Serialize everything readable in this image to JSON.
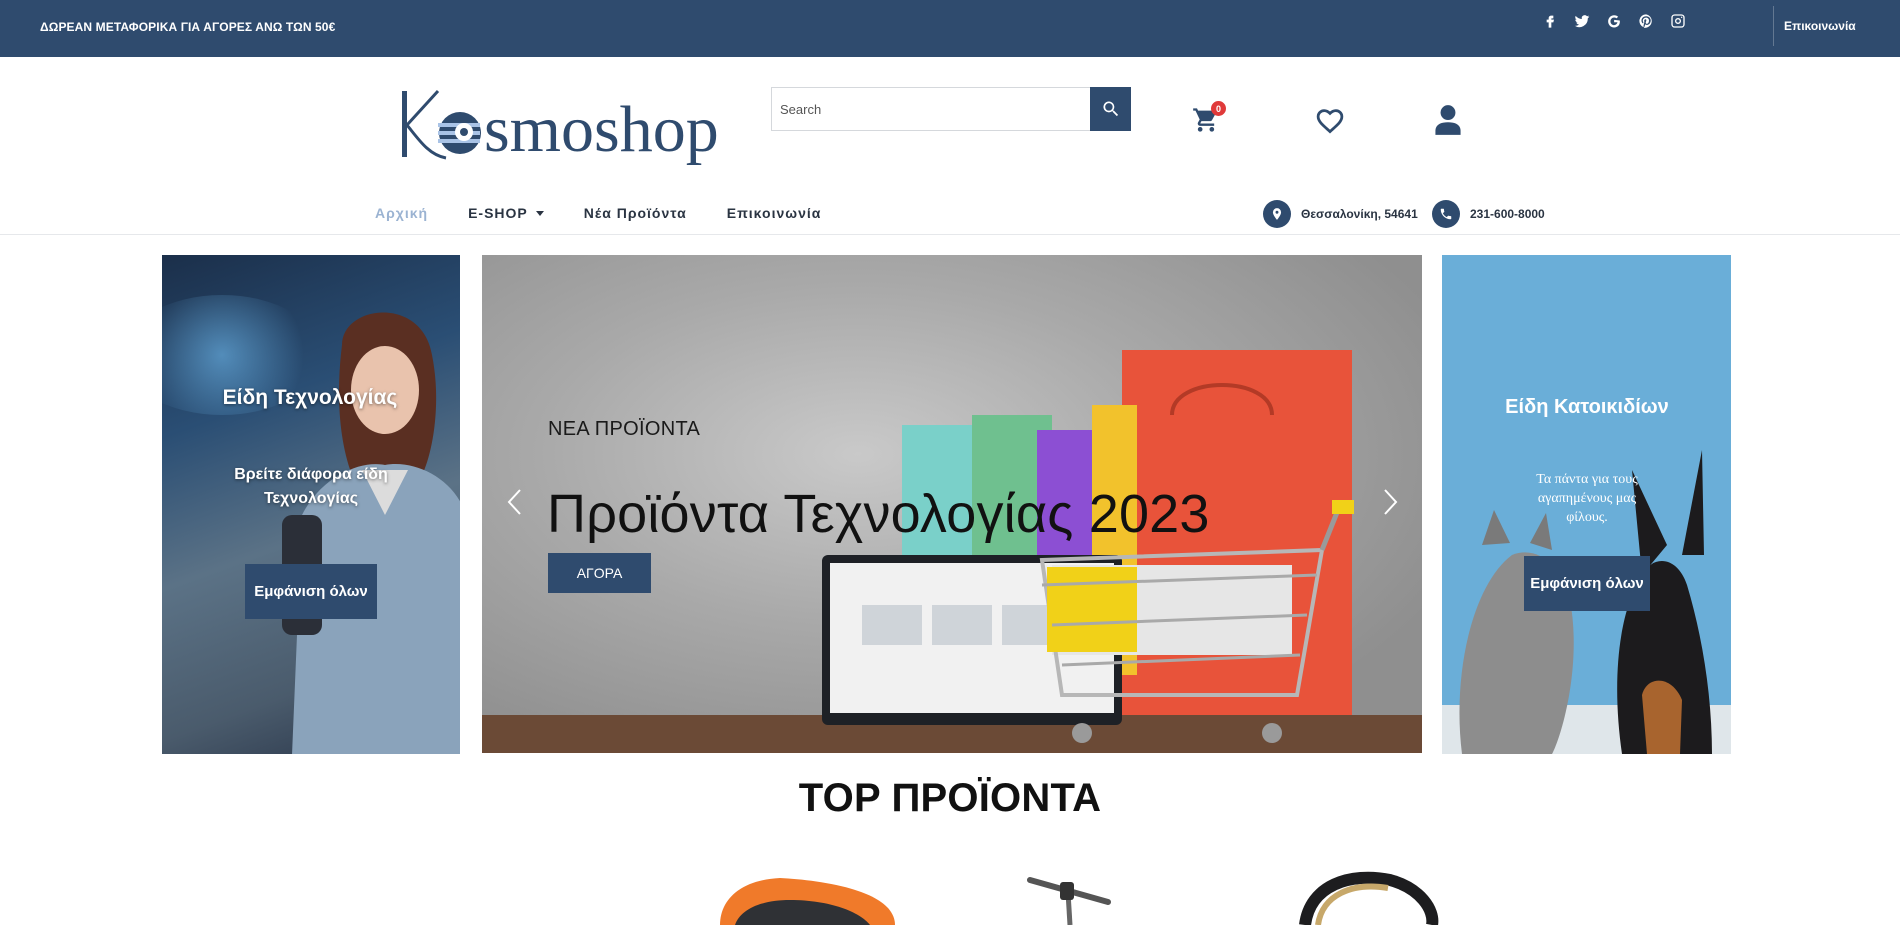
{
  "topbar": {
    "promo": "ΔΩΡΕΑΝ ΜΕΤΑΦΟΡΙΚΑ ΓΙΑ ΑΓΟΡΕΣ ΑΝΩ ΤΩΝ 50€",
    "social_icons": [
      "facebook-icon",
      "twitter-icon",
      "google-icon",
      "pinterest-icon",
      "instagram-icon"
    ],
    "contact_link": "Επικοινωνία"
  },
  "header": {
    "logo_text": "Kosmoshop",
    "search_placeholder": "Search",
    "cart_count": "0"
  },
  "nav": {
    "items": [
      "Αρχική",
      "E-SHOP",
      "Νέα Προϊόντα",
      "Επικοινωνία"
    ],
    "address": "Θεσσαλονίκη, 54641",
    "phone": "231-600-8000"
  },
  "left_banner": {
    "heading": "Είδη Τεχνολογίας",
    "text": "Βρείτε διάφορα είδη Τεχνολογίας",
    "button": "Εμφάνιση όλων"
  },
  "hero": {
    "kicker": "ΝΕΑ ΠΡΟΪΟΝΤΑ",
    "title": "Προϊόντα Τεχνολογίας 2023",
    "button": "ΑΓΟΡΑ"
  },
  "right_banner": {
    "heading": "Είδη Κατοικιδίων",
    "text": "Τα πάντα για τους αγαπημένους μας φίλους.",
    "button": "Εμφάνιση όλων"
  },
  "section": {
    "title": "TOP ΠΡΟΪΟΝΤΑ"
  },
  "colors": {
    "brand": "#2f4b6e",
    "badge": "#e03a3a",
    "nav_active": "#9bb3d2"
  }
}
